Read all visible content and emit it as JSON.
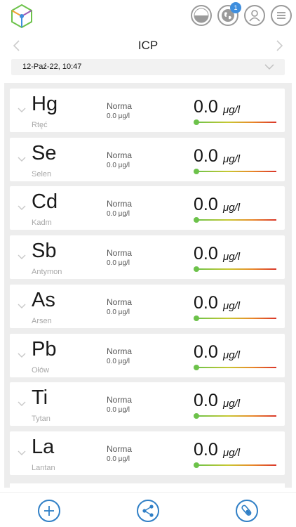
{
  "header": {
    "title": "ICP",
    "notification_count": "1"
  },
  "date_selector": {
    "value": "12-Paź-22, 10:47"
  },
  "colors": {
    "accent": "#2f7fc6",
    "badge": "#3e8ede",
    "gauge_start": "#6cc24a",
    "gauge_end": "#d9362a"
  },
  "icons": {
    "top": [
      "app-logo-cube-icon",
      "half-circle-icon",
      "globe-icon",
      "user-icon",
      "menu-icon"
    ],
    "bottom": [
      "add-icon",
      "share-icon",
      "test-tube-icon"
    ]
  },
  "elements": [
    {
      "symbol": "Hg",
      "name": "Rtęć",
      "norm_label": "Norma",
      "norm_value": "0.0 μg/l",
      "value": "0.0",
      "unit": "μg/l"
    },
    {
      "symbol": "Se",
      "name": "Selen",
      "norm_label": "Norma",
      "norm_value": "0.0 μg/l",
      "value": "0.0",
      "unit": "μg/l"
    },
    {
      "symbol": "Cd",
      "name": "Kadm",
      "norm_label": "Norma",
      "norm_value": "0.0 μg/l",
      "value": "0.0",
      "unit": "μg/l"
    },
    {
      "symbol": "Sb",
      "name": "Antymon",
      "norm_label": "Norma",
      "norm_value": "0.0 μg/l",
      "value": "0.0",
      "unit": "μg/l"
    },
    {
      "symbol": "As",
      "name": "Arsen",
      "norm_label": "Norma",
      "norm_value": "0.0 μg/l",
      "value": "0.0",
      "unit": "μg/l"
    },
    {
      "symbol": "Pb",
      "name": "Ołów",
      "norm_label": "Norma",
      "norm_value": "0.0 μg/l",
      "value": "0.0",
      "unit": "μg/l"
    },
    {
      "symbol": "Ti",
      "name": "Tytan",
      "norm_label": "Norma",
      "norm_value": "0.0 μg/l",
      "value": "0.0",
      "unit": "μg/l"
    },
    {
      "symbol": "La",
      "name": "Lantan",
      "norm_label": "Norma",
      "norm_value": "0.0 μg/l",
      "value": "0.0",
      "unit": "μg/l"
    }
  ]
}
